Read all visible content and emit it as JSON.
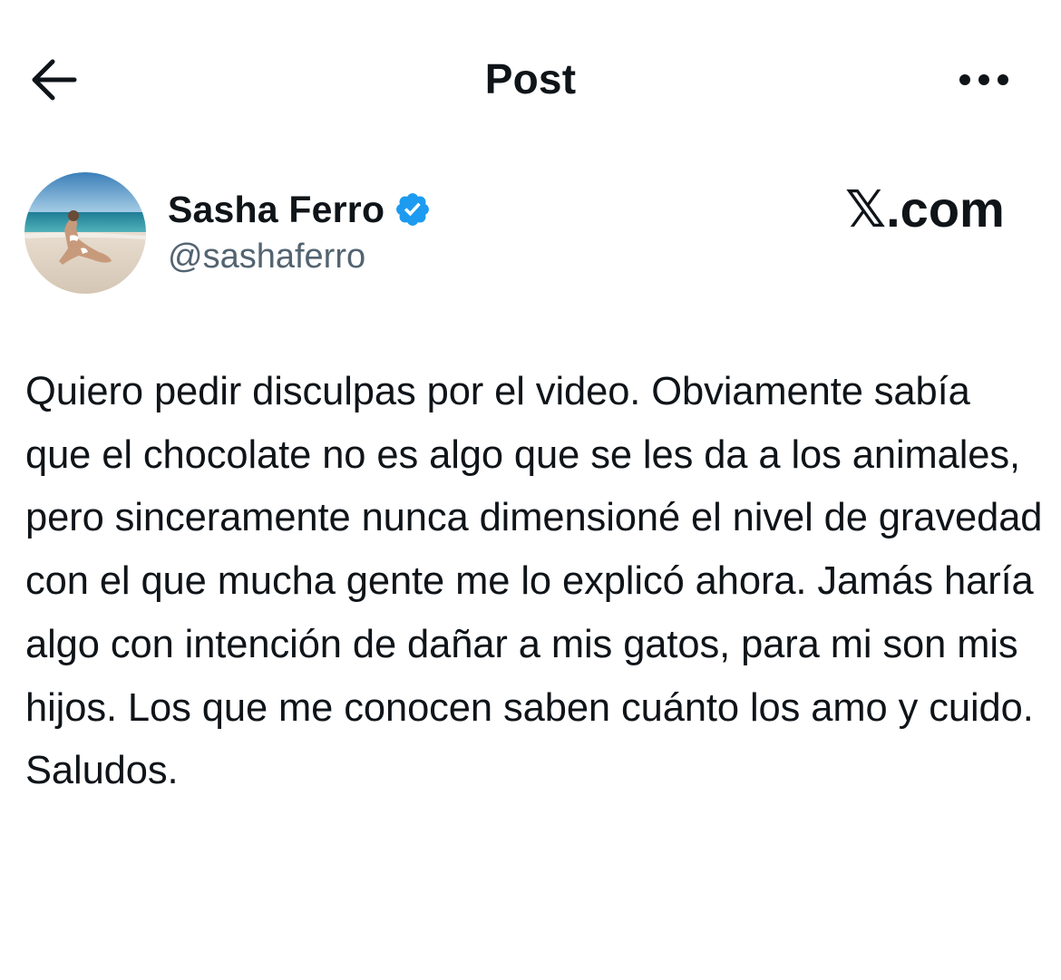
{
  "header": {
    "back_icon": "arrow-left-icon",
    "title": "Post",
    "more_icon": "more-horizontal-icon"
  },
  "post": {
    "author": {
      "display_name": "Sasha Ferro",
      "handle": "@sashaferro",
      "verified": true,
      "verified_color": "#1d9bf0",
      "avatar": "beach-photo-avatar"
    },
    "watermark": "𝕏.com",
    "text": "Quiero pedir disculpas por el video. Obviamente sabía que el chocolate no es algo que se les da a los animales, pero sinceramente nunca dimensioné el nivel de gravedad con el que mucha gente me lo explicó ahora. Jamás haría algo con intención de dañar a mis gatos, para mi son mis hijos. Los que me conocen saben cuánto los amo y cuido.\nSaludos."
  },
  "colors": {
    "text_primary": "#0f1419",
    "text_secondary": "#536471",
    "accent": "#1d9bf0",
    "background": "#ffffff"
  }
}
